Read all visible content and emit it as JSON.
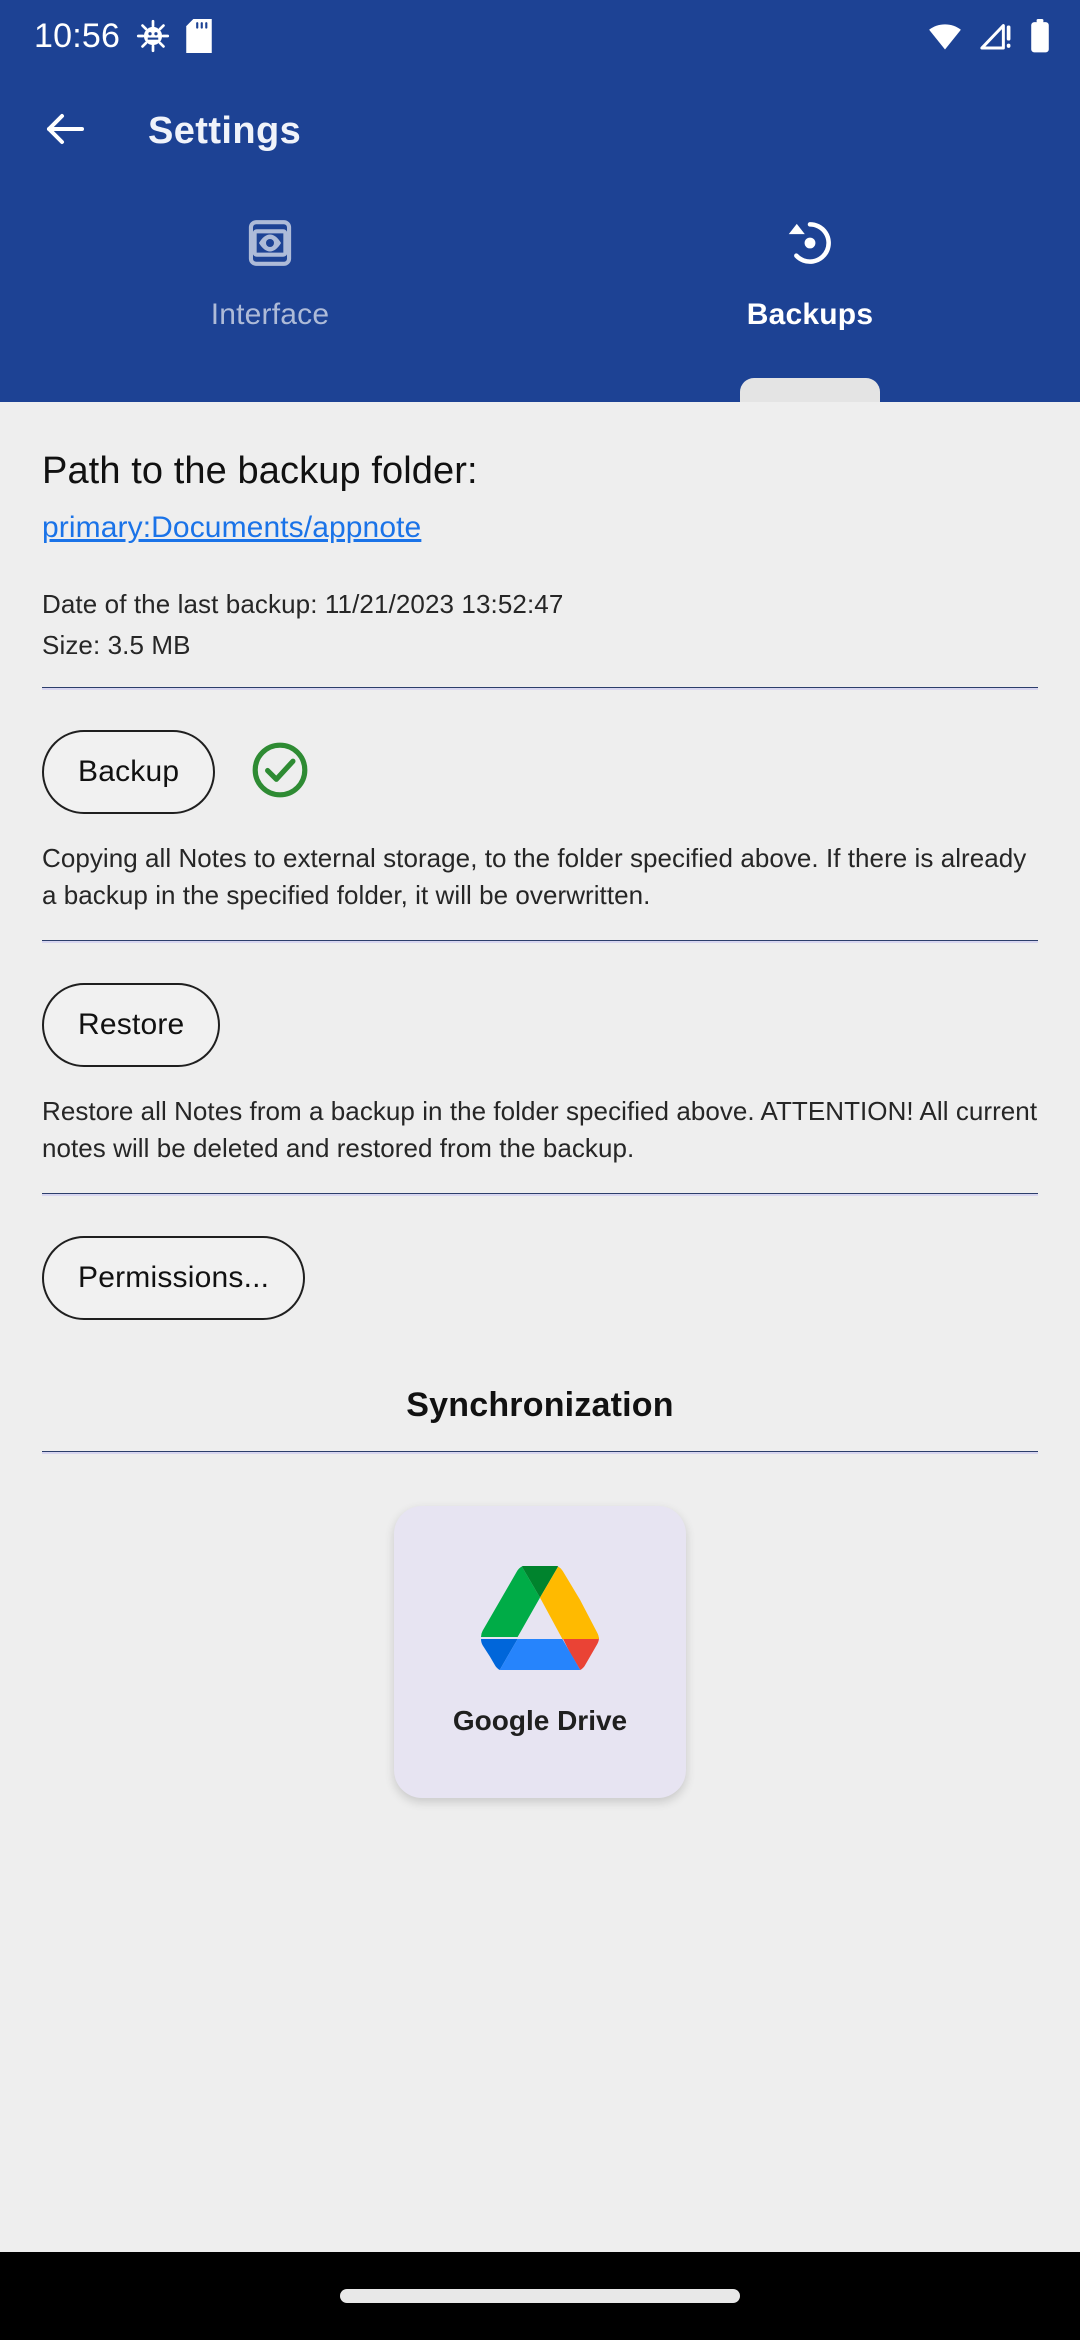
{
  "status_bar": {
    "time": "10:56",
    "left_icons": [
      "android-debug-icon",
      "sd-card-icon"
    ],
    "right_icons": [
      "wifi-icon",
      "cellular-no-service-icon",
      "battery-full-icon"
    ]
  },
  "app_bar": {
    "back_icon": "arrow-back-icon",
    "title": "Settings"
  },
  "tabs": [
    {
      "label": "Interface",
      "icon": "preview-eye-icon",
      "active": false
    },
    {
      "label": "Backups",
      "icon": "backup-restore-icon",
      "active": true
    }
  ],
  "backup_section": {
    "path_title": "Path to the backup folder:",
    "path_value": "primary:Documents/appnote",
    "last_backup": "Date of the last backup: 11/21/2023 13:52:47",
    "size": "Size: 3.5 MB",
    "backup_button": "Backup",
    "backup_status_icon": "check-circle-icon",
    "backup_description": "Copying all Notes to external storage, to the folder specified above. If there is already a backup in the specified folder, it will be overwritten.",
    "restore_button": "Restore",
    "restore_description": "Restore all Notes from a backup in the folder specified above. ATTENTION! All current notes will be deleted and restored from the backup.",
    "permissions_button": "Permissions..."
  },
  "sync_section": {
    "heading": "Synchronization",
    "providers": [
      {
        "label": "Google Drive",
        "icon": "google-drive-icon"
      }
    ]
  },
  "nav_bar": {
    "handle": "gesture-home-handle"
  },
  "colors": {
    "header_blue": "#1d4294",
    "content_bg": "#eeeeee",
    "link_blue": "#1a73e8",
    "divider_navy": "#2c3e6b",
    "success_green": "#2e8b33",
    "card_bg": "#e7e4f2"
  }
}
